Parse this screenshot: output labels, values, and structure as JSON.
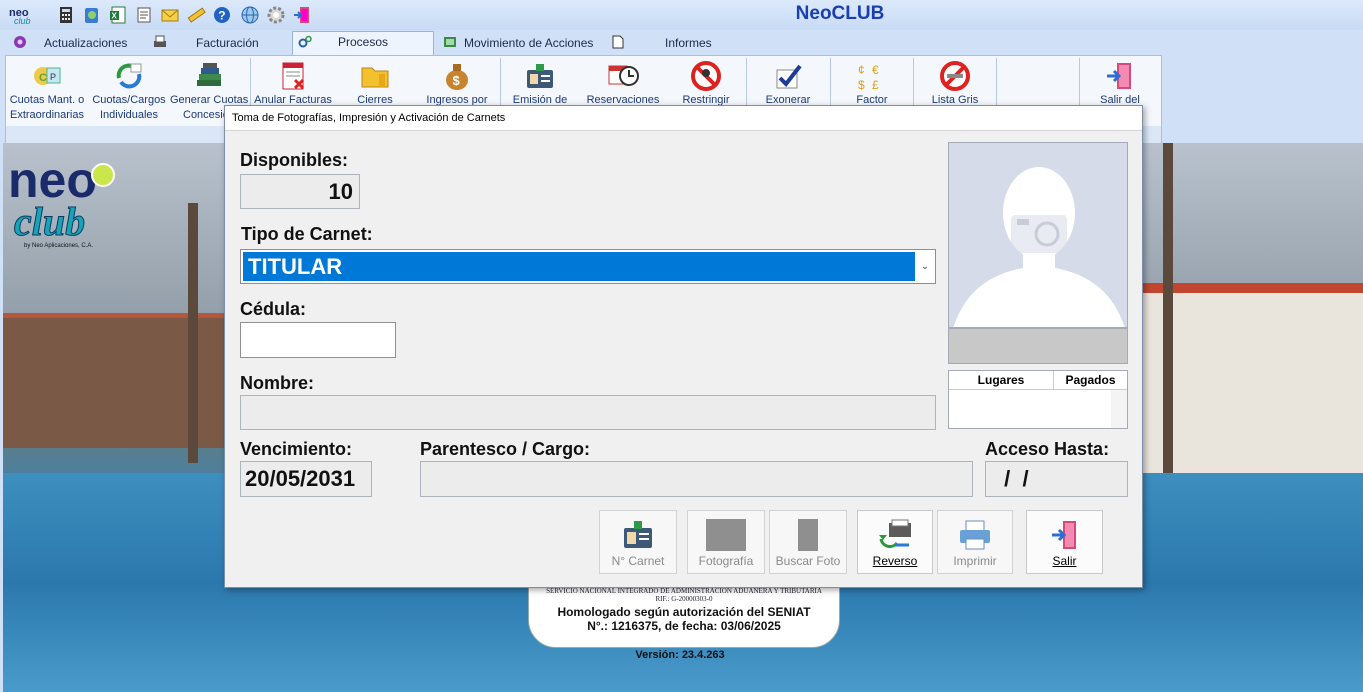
{
  "app": {
    "title": "NeoCLUB"
  },
  "menu": {
    "tabs": [
      {
        "label": "Actualizaciones"
      },
      {
        "label": "Facturación"
      },
      {
        "label": "Procesos",
        "active": true
      },
      {
        "label": "Movimiento de Acciones"
      },
      {
        "label": "Informes"
      }
    ]
  },
  "ribbon": {
    "buttons": [
      {
        "line1": "Cuotas Mant. o",
        "line2": "Extraordinarias",
        "icon": "cuotas-icon"
      },
      {
        "line1": "Cuotas/Cargos",
        "line2": "Individuales",
        "icon": "refresh-arrows-icon"
      },
      {
        "line1": "Generar Cuotas",
        "line2": "Concesion",
        "icon": "books-icon"
      },
      {
        "line1": "Anular Facturas",
        "line2": "",
        "icon": "invoice-cancel-icon"
      },
      {
        "line1": "Cierres",
        "line2": "",
        "icon": "folder-icon"
      },
      {
        "line1": "Ingresos por",
        "line2": "",
        "icon": "money-bag-icon"
      },
      {
        "line1": "Emisión de",
        "line2": "",
        "icon": "id-card-icon"
      },
      {
        "line1": "Reservaciones",
        "line2": "",
        "icon": "calendar-clock-icon"
      },
      {
        "line1": "Restringir",
        "line2": "",
        "icon": "restrict-icon"
      },
      {
        "line1": "Exonerar",
        "line2": "",
        "icon": "checkmark-icon"
      },
      {
        "line1": "Factor",
        "line2": "",
        "icon": "currency-icon"
      },
      {
        "line1": "Lista Gris",
        "line2": "",
        "icon": "no-smoking-icon"
      },
      {
        "line1": "Salir del",
        "line2": "",
        "icon": "exit-door-icon"
      }
    ]
  },
  "background": {
    "seniat": {
      "line1": "SERVICIO NACIONAL INTEGRADO DE ADMINISTRACIÓN ADUANERA Y TRIBUTARIA",
      "line2": "RIF.: G-20000303-0",
      "line3": "Homologado según autorización del SENIAT",
      "line4": "N°.: 1216375, de fecha: 03/06/2025"
    },
    "version": "Versión: 23.4.263"
  },
  "dialog": {
    "title": "Toma de Fotografías, Impresión y Activación de Carnets",
    "disponibles_label": "Disponibles:",
    "disponibles_value": "10",
    "tipo_label": "Tipo de Carnet:",
    "tipo_value": "TITULAR",
    "cedula_label": "Cédula:",
    "cedula_value": "",
    "nombre_label": "Nombre:",
    "nombre_value": "",
    "vencimiento_label": "Vencimiento:",
    "vencimiento_value": "20/05/2031",
    "parentesco_label": "Parentesco / Cargo:",
    "parentesco_value": "",
    "acceso_label": "Acceso Hasta:",
    "acceso_value": " /  /",
    "lugares_header": "Lugares",
    "pagados_header": "Pagados",
    "buttons": {
      "carnet": "N° Carnet",
      "fotografia": "Fotografía",
      "buscar": "Buscar Foto",
      "reverso": "Reverso",
      "imprimir": "Imprimir",
      "salir": "Salir"
    }
  },
  "colors": {
    "accent": "#0078d7",
    "title": "#1a3fb0"
  }
}
